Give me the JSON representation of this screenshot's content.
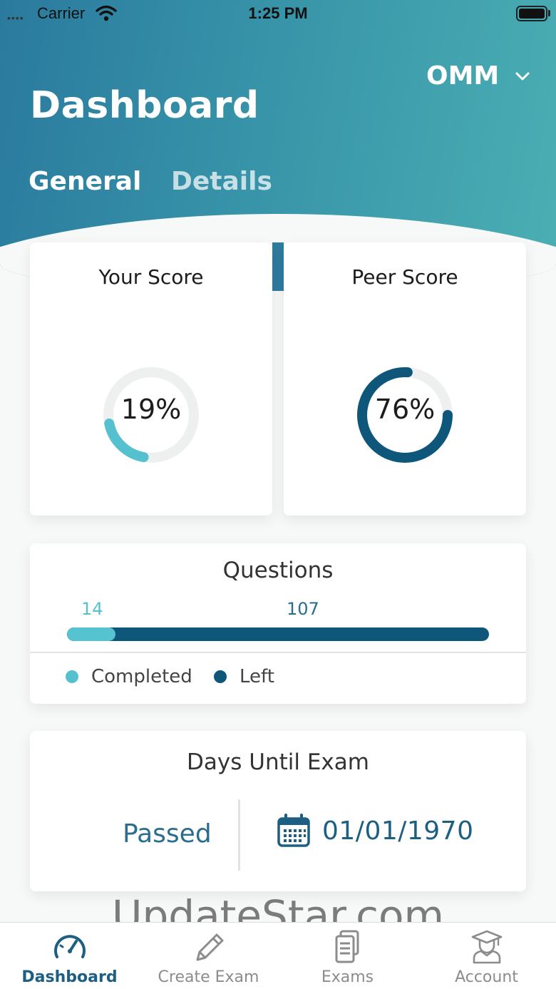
{
  "status_bar": {
    "carrier": "Carrier",
    "time": "1:25 PM"
  },
  "header": {
    "title": "Dashboard",
    "exam_selector": "OMM",
    "tabs": [
      {
        "label": "General",
        "active": true
      },
      {
        "label": "Details",
        "active": false
      }
    ]
  },
  "scores": {
    "your": {
      "title": "Your Score",
      "percent_label": "19%",
      "value": 19,
      "color": "#55c1cf"
    },
    "peer": {
      "title": "Peer Score",
      "percent_label": "76%",
      "value": 76,
      "color": "#0e577a"
    }
  },
  "questions": {
    "title": "Questions",
    "completed": "14",
    "left": "107",
    "legend": {
      "completed": "Completed",
      "left": "Left"
    },
    "completed_color": "#55c1cf",
    "left_color": "#0e577a"
  },
  "days_until_exam": {
    "title": "Days Until Exam",
    "status": "Passed",
    "date": "01/01/1970",
    "icon": "calendar-icon"
  },
  "watermark": "UpdateStar.com",
  "tab_bar": [
    {
      "label": "Dashboard",
      "icon": "speedometer-icon",
      "active": true
    },
    {
      "label": "Create Exam",
      "icon": "pencil-icon",
      "active": false
    },
    {
      "label": "Exams",
      "icon": "documents-icon",
      "active": false
    },
    {
      "label": "Account",
      "icon": "graduate-icon",
      "active": false
    }
  ],
  "colors": {
    "accent": "#1d5f83",
    "teal": "#55c1cf",
    "navy": "#0e577a"
  }
}
